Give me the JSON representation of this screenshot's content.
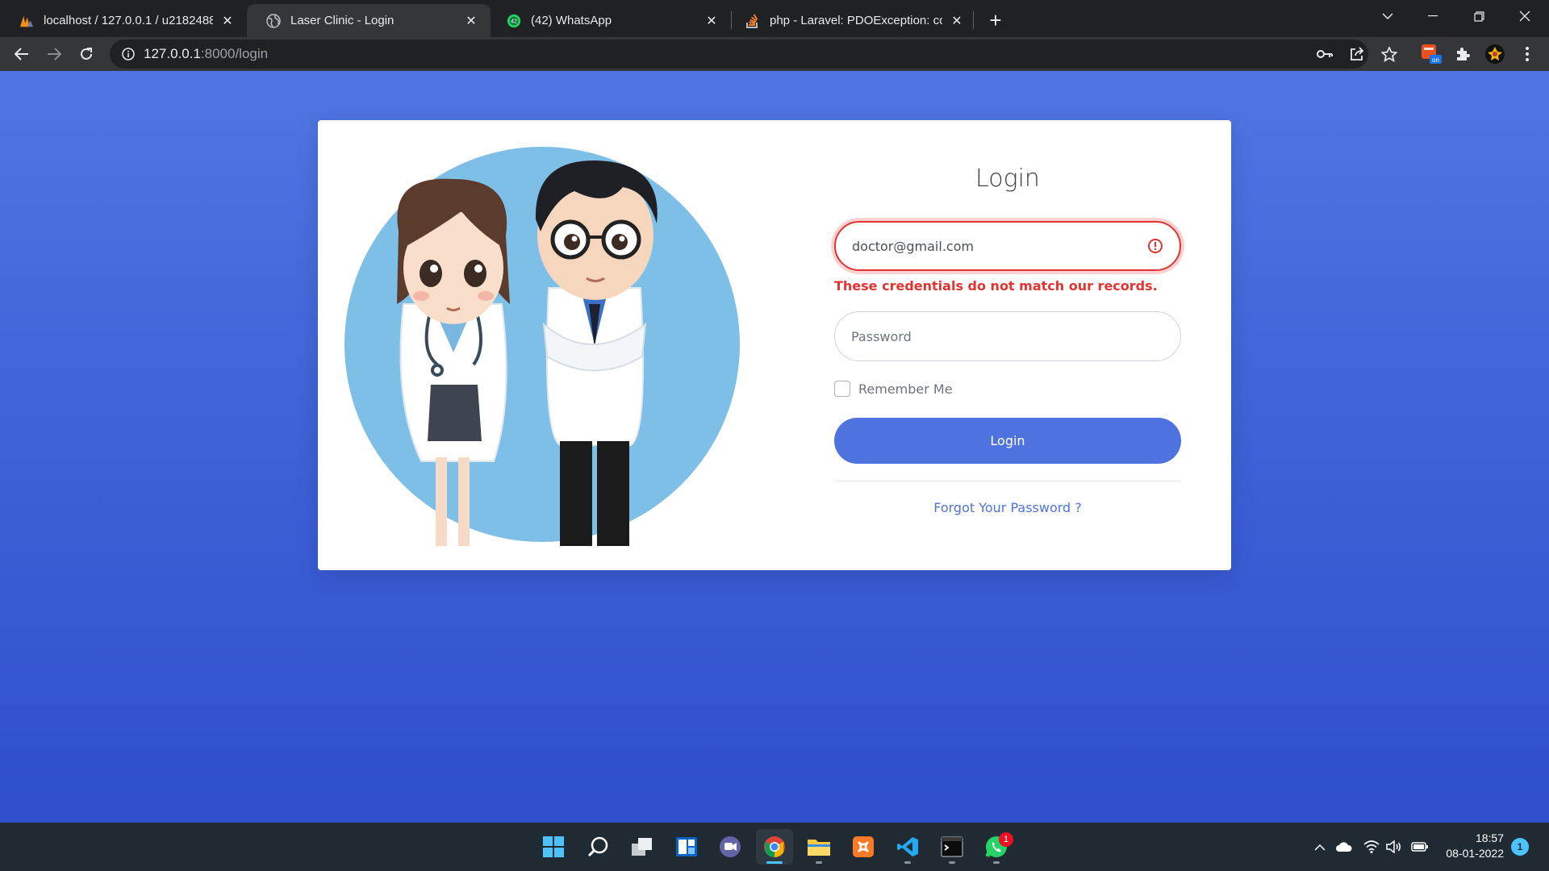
{
  "browser": {
    "tabs": [
      {
        "title": "localhost / 127.0.0.1 / u21824884",
        "icon": "phpmyadmin-icon",
        "active": false
      },
      {
        "title": "Laser Clinic - Login",
        "icon": "globe-icon",
        "active": true
      },
      {
        "title": "(42) WhatsApp",
        "icon": "whatsapp-icon",
        "badge": "42",
        "active": false
      },
      {
        "title": "php - Laravel: PDOException: cou",
        "icon": "stackoverflow-icon",
        "active": false
      }
    ],
    "url_host": "127.0.0.1",
    "url_path": ":8000/login"
  },
  "login": {
    "title": "Login",
    "email_value": "doctor@gmail.com",
    "error_message": "These credentials do not match our records.",
    "password_placeholder": "Password",
    "remember_label": "Remember Me",
    "button_label": "Login",
    "forgot_label": "Forgot Your Password ?"
  },
  "taskbar": {
    "apps": [
      "start",
      "search",
      "task-view",
      "widgets",
      "teams-chat",
      "chrome",
      "file-explorer",
      "xampp",
      "vscode",
      "terminal",
      "whatsapp"
    ],
    "whatsapp_badge": "1",
    "time": "18:57",
    "date": "08-01-2022",
    "notification_count": "1"
  },
  "colors": {
    "accent": "#4e73df",
    "error": "#e3342f",
    "background_top": "#5076e2",
    "background_bottom": "#2f4fcb"
  }
}
